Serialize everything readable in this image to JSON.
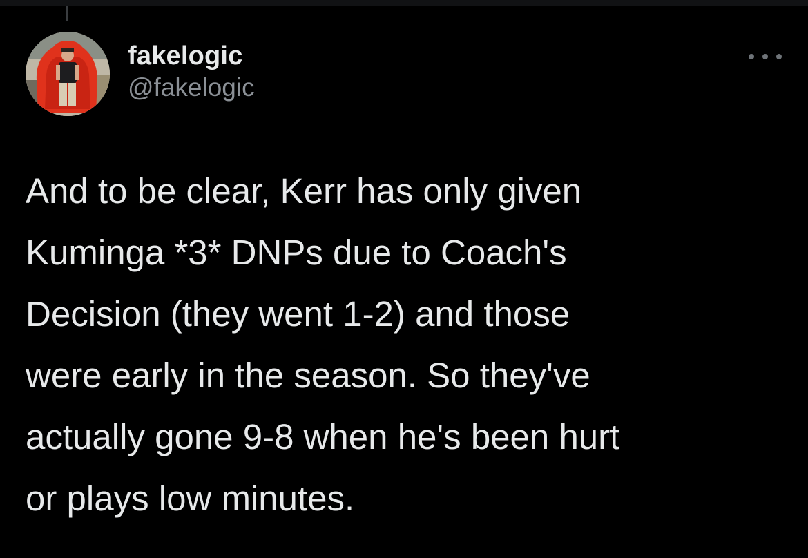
{
  "tweet": {
    "author": {
      "display_name": "fakelogic",
      "handle": "@fakelogic",
      "avatar_icon": "user-avatar"
    },
    "more_icon": "more-horizontal-icon",
    "text_lines": [
      "And to be clear, Kerr has only given",
      "Kuminga *3* DNPs due to Coach's",
      "Decision (they went 1-2) and those",
      "were early in the season. So they've",
      "actually gone 9-8 when he's been hurt",
      "or plays low minutes."
    ]
  },
  "colors": {
    "background": "#000000",
    "primary_text": "#e7e9ea",
    "secondary_text": "#8b9096",
    "icon": "#6e7378"
  }
}
